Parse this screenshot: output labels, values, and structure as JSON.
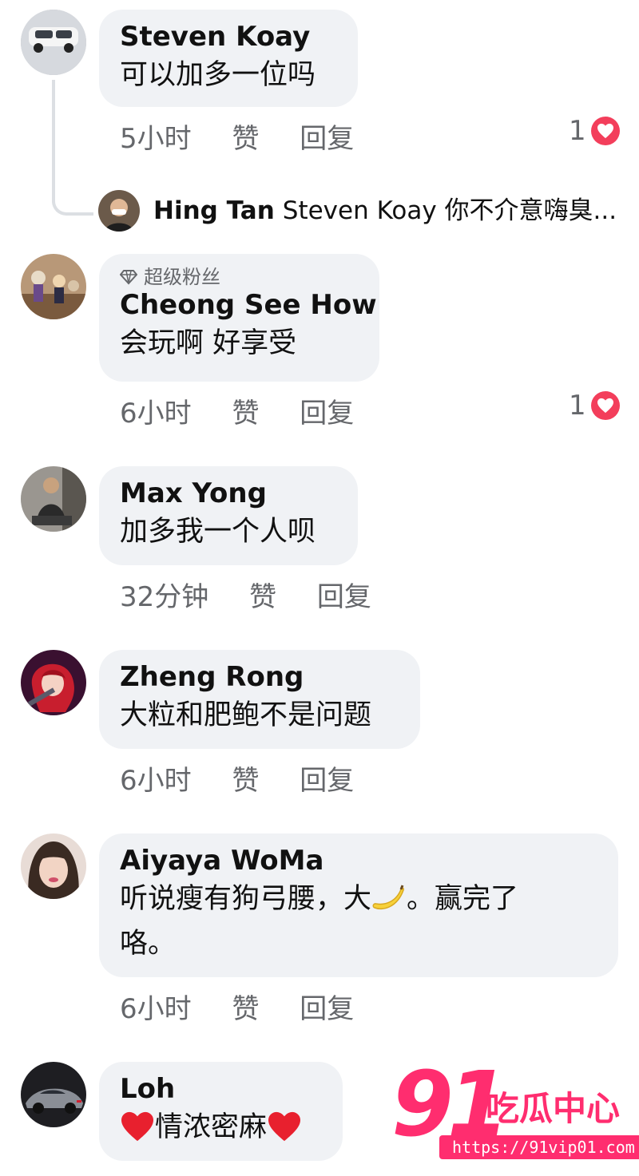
{
  "comments": [
    {
      "author": "Steven Koay",
      "text": "可以加多一位吗",
      "time": "5小时",
      "like_label": "赞",
      "reply_label": "回复",
      "reaction_count": "1",
      "reaction_icon": "heart-icon"
    },
    {
      "badge_label": "超级粉丝",
      "badge_icon": "diamond-icon",
      "author": "Cheong See How",
      "text": "会玩啊 好享受",
      "time": "6小时",
      "like_label": "赞",
      "reply_label": "回复",
      "reaction_count": "1",
      "reaction_icon": "heart-icon"
    },
    {
      "author": "Max Yong",
      "text": "加多我一个人呗",
      "time": "32分钟",
      "like_label": "赞",
      "reply_label": "回复"
    },
    {
      "author": "Zheng Rong",
      "text": "大粒和肥鲍不是问题",
      "time": "6小时",
      "like_label": "赞",
      "reply_label": "回复"
    },
    {
      "author": "Aiyaya WoMa",
      "text_line1_start": "听说瘦有狗弓腰，大",
      "text_line1_emoji": "banana-icon",
      "text_line1_end": "。赢完了",
      "text_line2": "咯。",
      "time": "6小时",
      "like_label": "赞",
      "reply_label": "回复"
    },
    {
      "author": "Loh",
      "text_emoji": "heart-icon",
      "text": "情浓密麻"
    }
  ],
  "reply_preview": {
    "author": "Hing Tan",
    "text": "Steven Koay 你不介意嗨臭..."
  },
  "watermark": {
    "number": "91",
    "title": "吃瓜中心",
    "url": "https://91vip01.com"
  },
  "colors": {
    "bubble": "#f0f2f5",
    "meta_text": "#65676b",
    "heart": "#f33e5b",
    "watermark": "#ff2d6f"
  }
}
